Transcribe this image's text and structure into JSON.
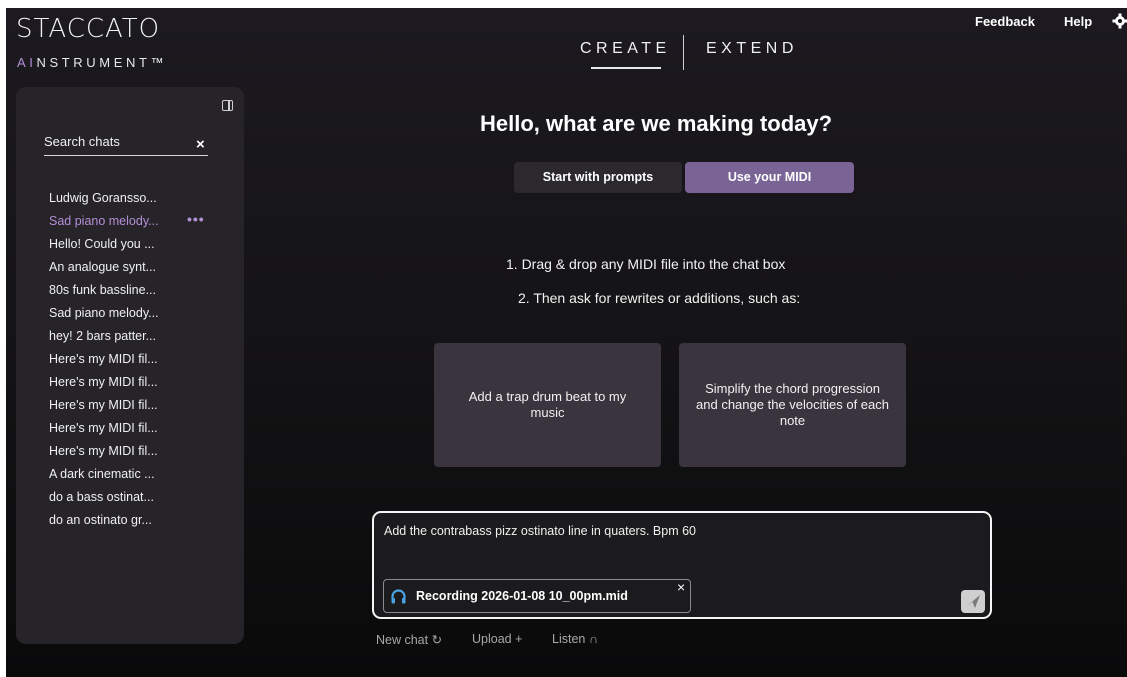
{
  "brand": {
    "name": "STACCATO",
    "sub_ai": "AI",
    "sub_rest": "NSTRUMENT™"
  },
  "nav": {
    "create": "CREATE",
    "extend": "EXTEND"
  },
  "header": {
    "feedback": "Feedback",
    "help": "Help",
    "settings_icon": "gear-icon"
  },
  "sidebar": {
    "search_placeholder": "Search chats",
    "clear_symbol": "×",
    "more_symbol": "•••",
    "chats": [
      {
        "label": "Ludwig Goransso..."
      },
      {
        "label": "Sad piano melody...",
        "active": true
      },
      {
        "label": "Hello! Could you ..."
      },
      {
        "label": "An analogue synt..."
      },
      {
        "label": "80s funk bassline..."
      },
      {
        "label": "Sad piano melody..."
      },
      {
        "label": "hey! 2 bars patter..."
      },
      {
        "label": "Here's my MIDI fil..."
      },
      {
        "label": "Here's my MIDI fil..."
      },
      {
        "label": "Here's my MIDI fil..."
      },
      {
        "label": "Here's my MIDI fil..."
      },
      {
        "label": "Here's my MIDI fil..."
      },
      {
        "label": "A dark cinematic ..."
      },
      {
        "label": "do a bass ostinat..."
      },
      {
        "label": "do an ostinato gr..."
      }
    ]
  },
  "main": {
    "greeting": "Hello, what are we making today?",
    "tabs": {
      "prompts": "Start with prompts",
      "midi": "Use your MIDI"
    },
    "instructions": [
      "1. Drag & drop any MIDI file into the chat box",
      "2. Then ask for rewrites or additions, such as:"
    ],
    "cards": [
      "Add a trap drum beat to my music",
      "Simplify the chord progression and change the velocities of each note"
    ]
  },
  "composer": {
    "text": "Add the contrabass pizz ostinato line in quaters. Bpm 60",
    "attachment": "Recording 2026-01-08 10_00pm.mid",
    "remove_symbol": "×"
  },
  "actions": {
    "new_chat": "New chat ↻",
    "upload": "Upload +",
    "listen": "Listen ∩"
  },
  "colors": {
    "accent": "#b48fd6",
    "tab_active": "#7a6495",
    "card": "#3a343f",
    "headphones": "#4aa3e0"
  }
}
